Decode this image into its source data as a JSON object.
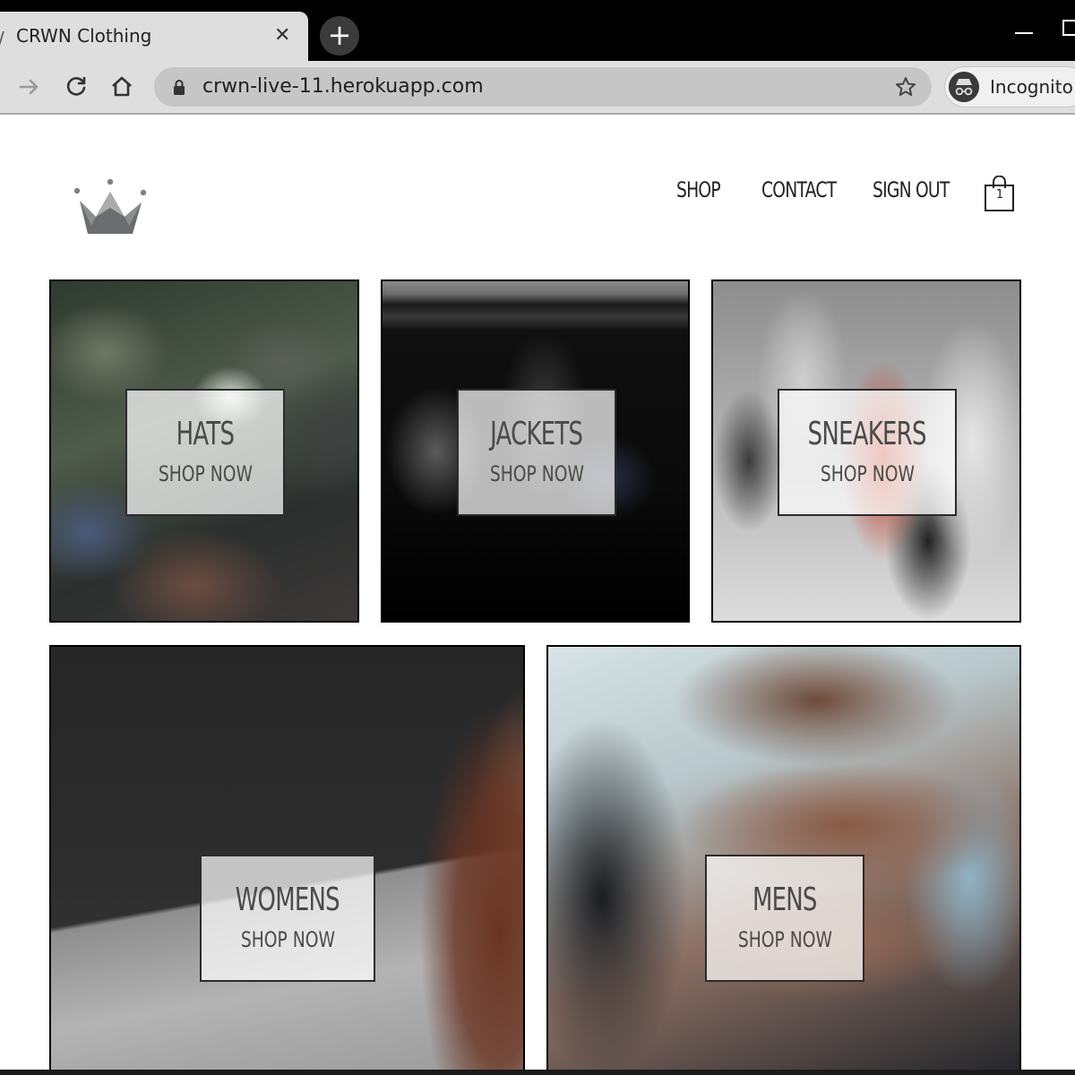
{
  "browser": {
    "tab_title": "CRWN Clothing",
    "tab_close": "✕",
    "new_tab": "+",
    "url": "crwn-live-11.herokuapp.com",
    "incognito_label": "Incognito"
  },
  "site": {
    "nav": {
      "shop": "SHOP",
      "contact": "CONTACT",
      "sign_out": "SIGN OUT"
    },
    "cart_count": "1"
  },
  "categories": [
    {
      "title": "HATS",
      "subtitle": "SHOP NOW"
    },
    {
      "title": "JACKETS",
      "subtitle": "SHOP NOW"
    },
    {
      "title": "SNEAKERS",
      "subtitle": "SHOP NOW"
    },
    {
      "title": "WOMENS",
      "subtitle": "SHOP NOW"
    },
    {
      "title": "MENS",
      "subtitle": "SHOP NOW"
    }
  ],
  "colors": {
    "text": "#222222",
    "tile_border": "#000000",
    "logo": "#808282"
  }
}
